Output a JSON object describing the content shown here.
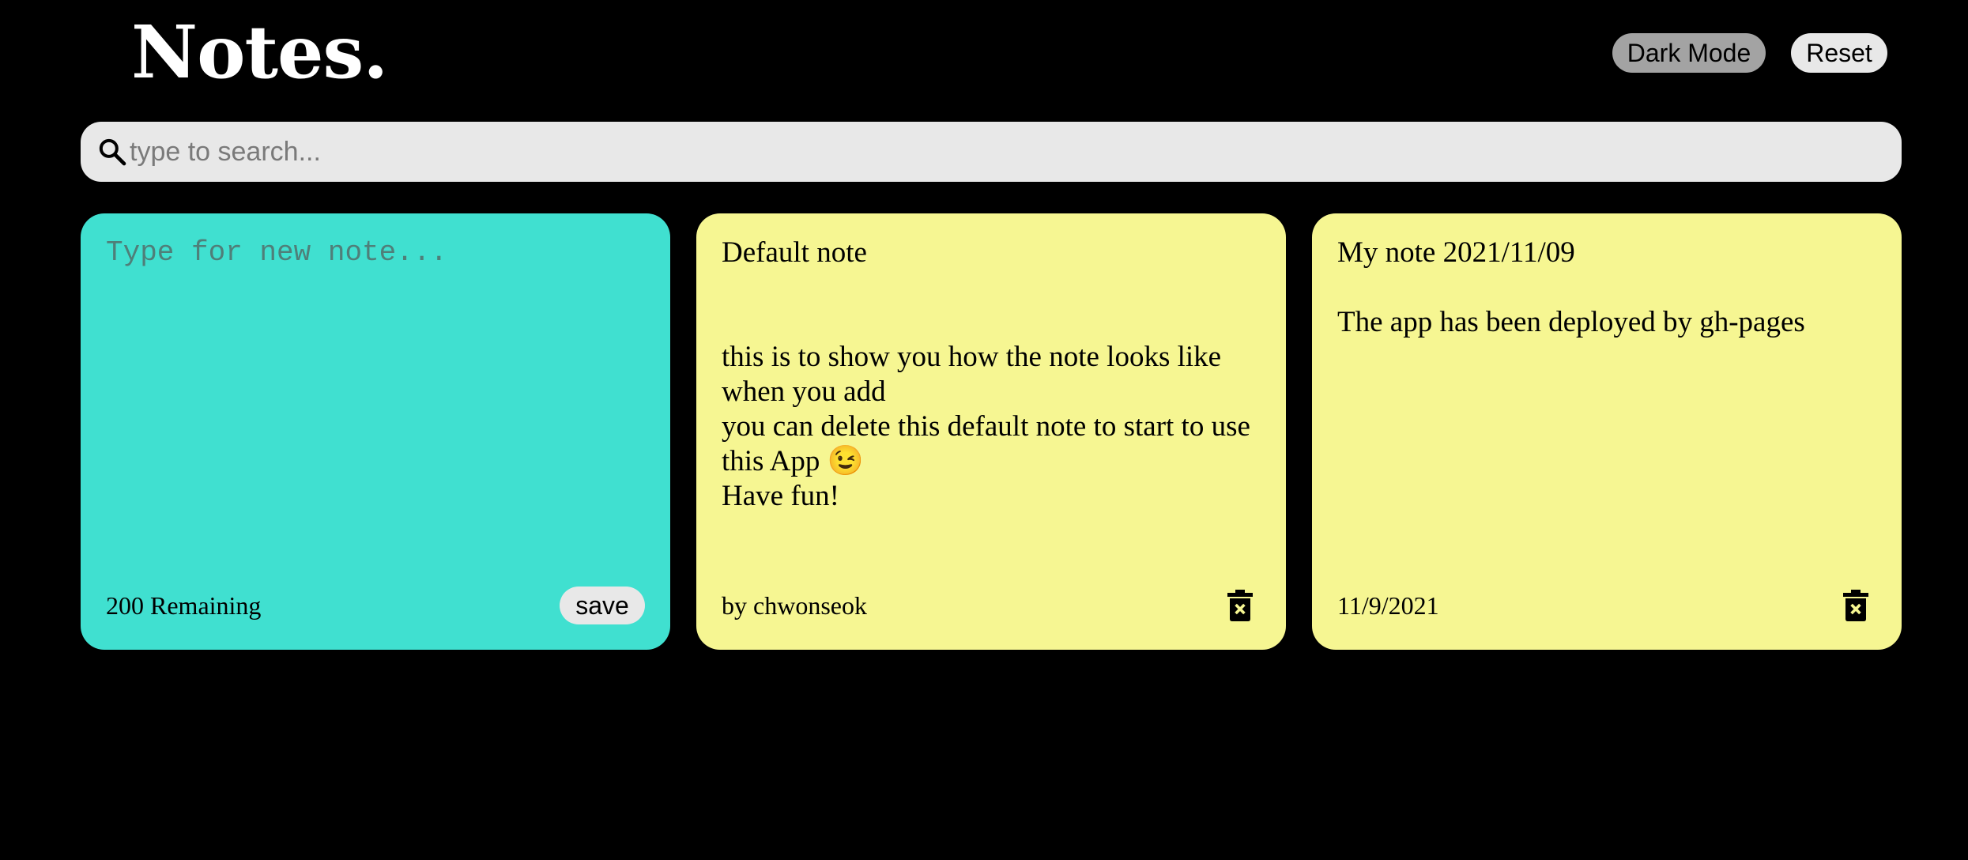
{
  "header": {
    "title": "Notes.",
    "dark_mode_label": "Dark Mode",
    "reset_label": "Reset"
  },
  "search": {
    "placeholder": "type to search...",
    "value": "",
    "icon": "search-icon"
  },
  "new_note": {
    "placeholder": "Type for new note...",
    "value": "",
    "remaining_text": "200 Remaining",
    "save_label": "save"
  },
  "notes": [
    {
      "text": "Default note\n\n\nthis is to show you how the note looks like when you add\nyou can delete this default note to start to use this App 😉\nHave fun!",
      "footer": "by chwonseok",
      "delete_icon": "trash-icon"
    },
    {
      "text": "My note 2021/11/09\n\nThe app has been deployed by gh-pages",
      "footer": "11/9/2021",
      "delete_icon": "trash-icon"
    }
  ],
  "colors": {
    "background": "#000000",
    "new_note": "#40e0d0",
    "note": "#f6f692",
    "dark_mode_button": "#a3a3a3",
    "light_button": "#e8e8e8",
    "search_bar": "#e8e8e8"
  }
}
